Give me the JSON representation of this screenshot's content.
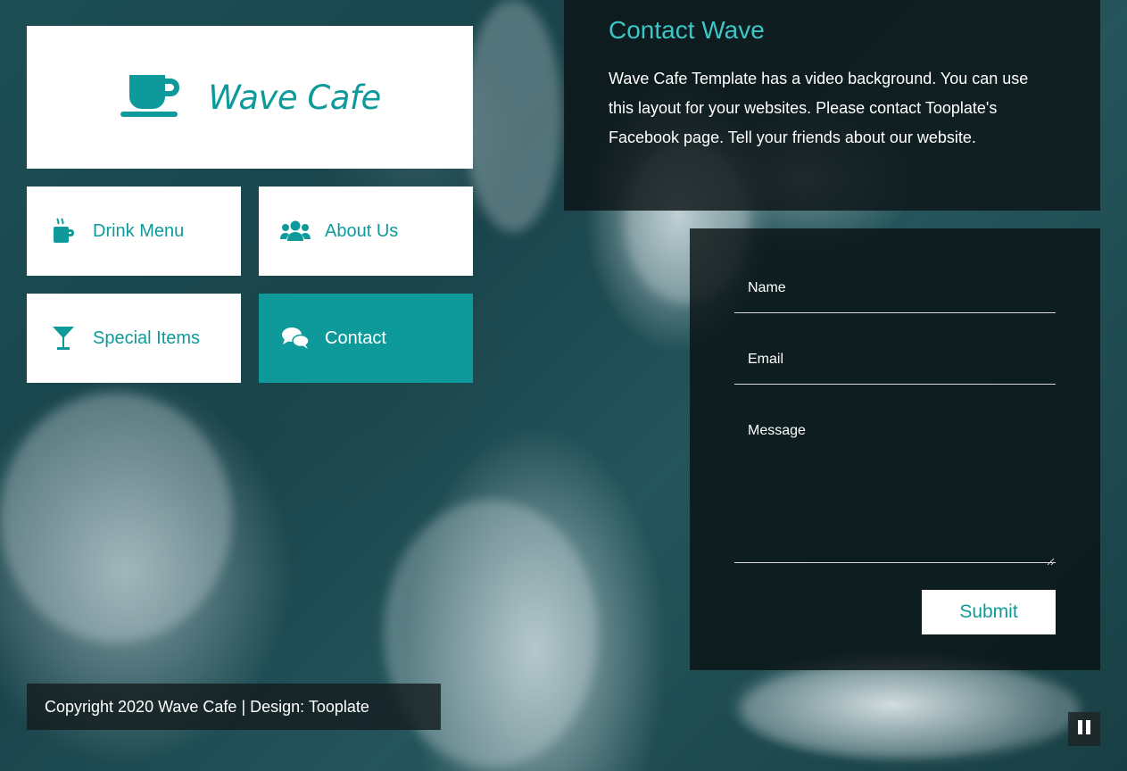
{
  "brand": {
    "name": "Wave Cafe",
    "logo_icon": "coffee-cup-icon",
    "accent_color": "#0e9a9a"
  },
  "nav": {
    "items": [
      {
        "label": "Drink Menu",
        "icon": "coffee-mug-icon",
        "active": false
      },
      {
        "label": "About Us",
        "icon": "users-icon",
        "active": false
      },
      {
        "label": "Special Items",
        "icon": "cocktail-glass-icon",
        "active": false
      },
      {
        "label": "Contact",
        "icon": "comments-icon",
        "active": true
      }
    ]
  },
  "info": {
    "title": "Contact Wave",
    "body": "Wave Cafe Template has a video background. You can use this layout for your websites. Please contact Tooplate's Facebook page. Tell your friends about our website."
  },
  "form": {
    "name_label": "Name",
    "email_label": "Email",
    "message_label": "Message",
    "submit_label": "Submit"
  },
  "footer": {
    "copyright": "Copyright 2020 Wave Cafe | Design: Tooplate"
  },
  "video_control": {
    "icon": "pause-icon"
  }
}
